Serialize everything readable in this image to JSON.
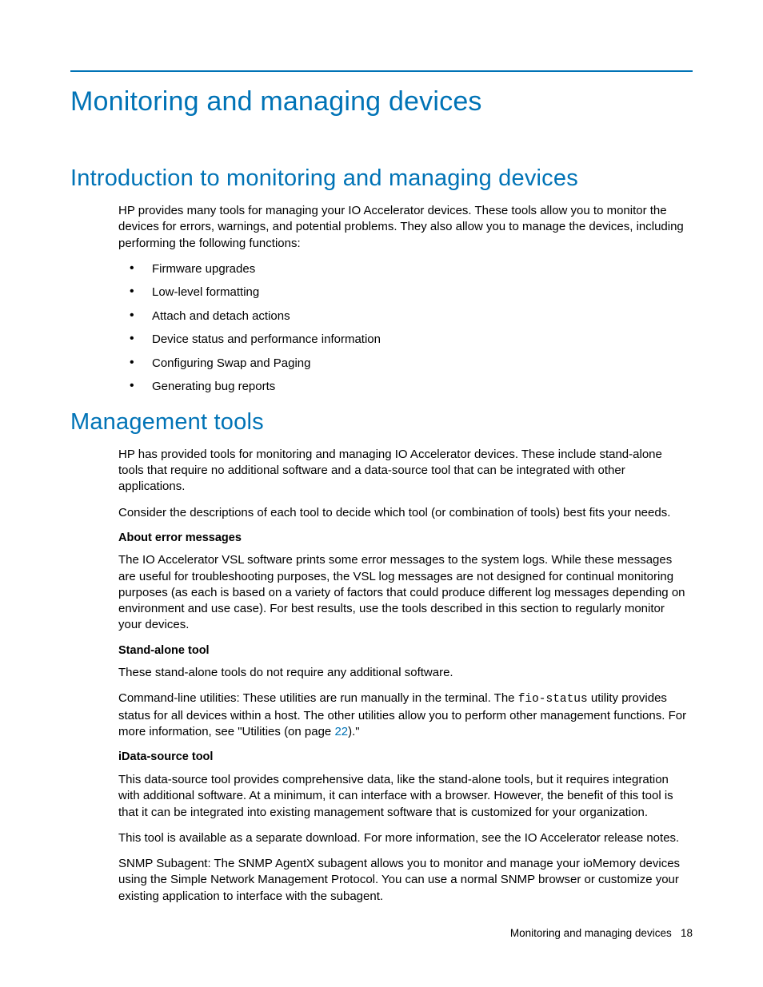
{
  "h1": "Monitoring and managing devices",
  "intro": {
    "heading": "Introduction to monitoring and managing devices",
    "para1": "HP provides many tools for managing your IO Accelerator devices. These tools allow you to monitor the devices for errors, warnings, and potential problems. They also allow you to manage the devices, including performing the following functions:",
    "bullets": [
      "Firmware upgrades",
      "Low-level formatting",
      "Attach and detach actions",
      "Device status and performance information",
      "Configuring Swap and Paging",
      "Generating bug reports"
    ]
  },
  "tools": {
    "heading": "Management tools",
    "para1": "HP has provided tools for monitoring and managing IO Accelerator devices. These include stand-alone tools that require no additional software and a data-source tool that can be integrated with other applications.",
    "para2": "Consider the descriptions of each tool to decide which tool (or combination of tools) best fits your needs.",
    "err_head": "About error messages",
    "err_body": "The IO Accelerator VSL software prints some error messages to the system logs. While these messages are useful for troubleshooting purposes, the VSL log messages are not designed for continual monitoring purposes (as each is based on a variety of factors that could produce different log messages depending on environment and use case). For best results, use the tools described in this section to regularly monitor your devices.",
    "sa_head": "Stand-alone tool",
    "sa_p1": "These stand-alone tools do not require any additional software.",
    "sa_p2_a": "Command-line utilities: These utilities are run manually in the terminal. The ",
    "sa_p2_code": "fio-status",
    "sa_p2_b": " utility provides status for all devices within a host. The other utilities allow you to perform other management functions. For more information, see \"Utilities (on page ",
    "sa_p2_link": "22",
    "sa_p2_c": ").\"",
    "ds_head": "iData-source tool",
    "ds_p1": "This data-source tool provides comprehensive data, like the stand-alone tools, but it requires integration with additional software. At a minimum, it can interface with a browser. However, the benefit of this tool is that it can be integrated into existing management software that is customized for your organization.",
    "ds_p2": "This tool is available as a separate download. For more information, see the IO Accelerator release notes.",
    "ds_p3": "SNMP Subagent: The SNMP AgentX subagent allows you to monitor and manage your ioMemory devices using the Simple Network Management Protocol. You can use a normal SNMP browser or customize your existing application to interface with the subagent."
  },
  "footer": {
    "section": "Monitoring and managing devices",
    "page": "18"
  }
}
